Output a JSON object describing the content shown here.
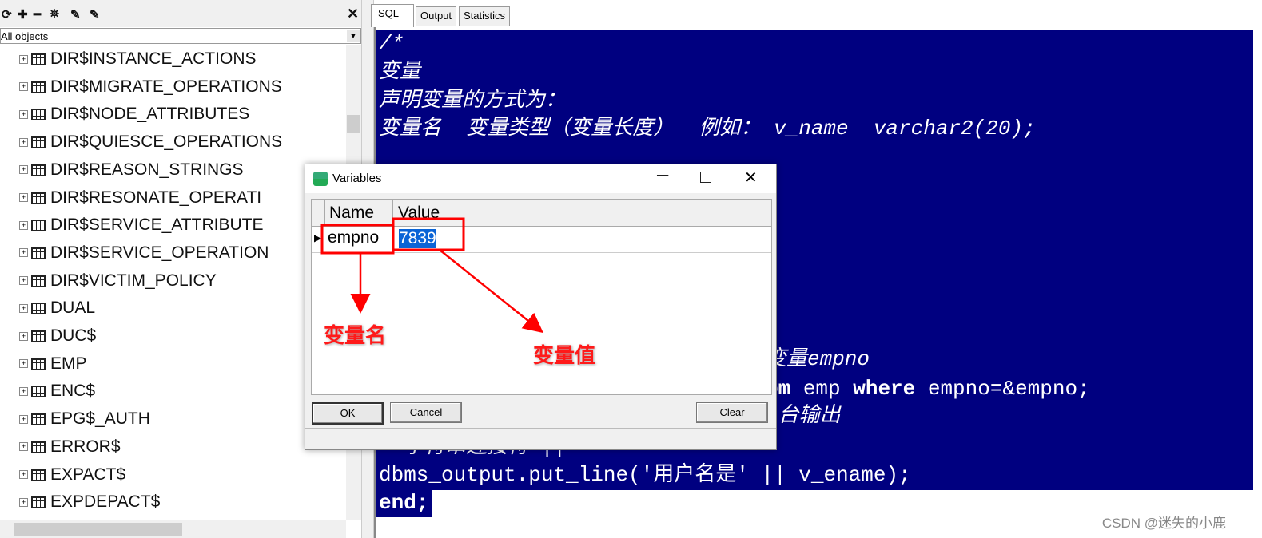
{
  "browser_panel": {
    "toolbar_icons": [
      "refresh-icon",
      "expand-icon",
      "collapse-icon",
      "find-icon",
      "filter-icon",
      "filter-settings-icon"
    ],
    "close": "✕",
    "filter": "All objects",
    "items": [
      "DIR$INSTANCE_ACTIONS",
      "DIR$MIGRATE_OPERATIONS",
      "DIR$NODE_ATTRIBUTES",
      "DIR$QUIESCE_OPERATIONS",
      "DIR$REASON_STRINGS",
      "DIR$RESONATE_OPERATI",
      "DIR$SERVICE_ATTRIBUTE",
      "DIR$SERVICE_OPERATION",
      "DIR$VICTIM_POLICY",
      "DUAL",
      "DUC$",
      "EMP",
      "ENC$",
      "EPG$_AUTH",
      "ERROR$",
      "EXPACT$",
      "EXPDEPACT$"
    ]
  },
  "tabs": [
    "SQL",
    "Output",
    "Statistics"
  ],
  "editor": {
    "lines": [
      "/*",
      "变量",
      "声明变量的方式为：",
      "变量名  变量类型（变量长度）  例如： v_name  varchar2(20);"
    ],
    "frag_comment": "变量empno",
    "frag_from": "om",
    "frag_emp": " emp ",
    "frag_where": "where",
    "frag_rest": " empno=&empno;",
    "frag_output": "|台输出",
    "frag_concat": "  字符串连接符 ||",
    "dbms_line": "dbms_output.put_line('用户名是' || v_ename);",
    "end_line": "end;",
    "selection_color": "#000080"
  },
  "dialog": {
    "title": "Variables",
    "columns": [
      "Name",
      "Value"
    ],
    "rows": [
      {
        "name": "empno",
        "value": "7839"
      }
    ],
    "buttons": {
      "ok": "OK",
      "cancel": "Cancel",
      "clear": "Clear"
    }
  },
  "annotations": {
    "name_label": "变量名",
    "value_label": "变量值",
    "color": "#ff0000"
  },
  "watermark": "CSDN @迷失的小鹿"
}
